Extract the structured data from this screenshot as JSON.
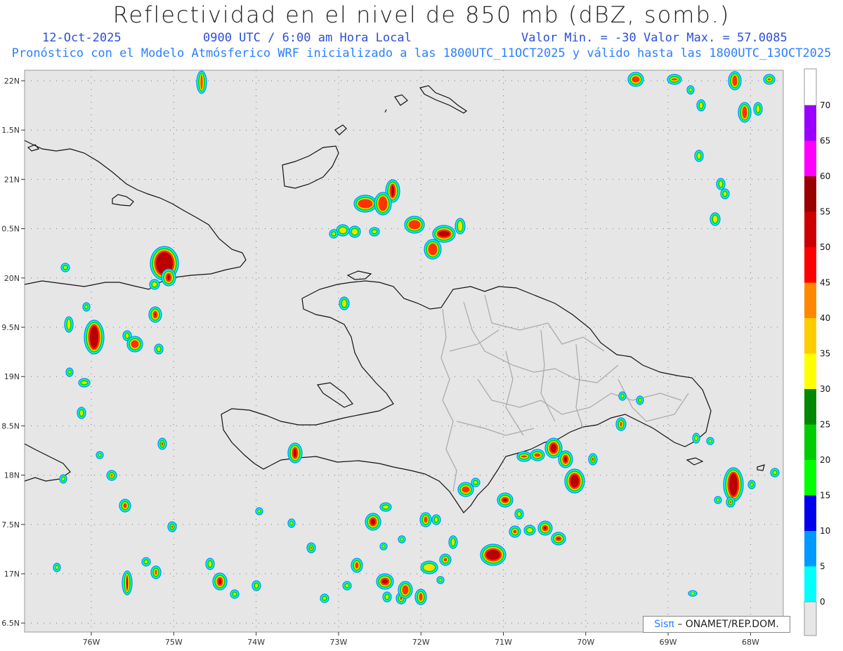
{
  "header": {
    "title": "Reflectividad en el nivel de 850 mb (dBZ, somb.)",
    "date": "12-Oct-2025",
    "time": "0900 UTC / 6:00 am Hora Local",
    "minmax": "Valor Min. = -30  Valor Max. = 57.0085",
    "forecast": "Pronóstico con el Modelo Atmósferico WRF inicializado a las 1800UTC_11OCT2025 y válido hasta las  1800UTC_13OCT2025"
  },
  "map": {
    "lat_labels": [
      "22N",
      "1.5N",
      "21N",
      "0.5N",
      "20N",
      "9.5N",
      "19N",
      "8.5N",
      "18N",
      "7.5N",
      "17N",
      "6.5N"
    ],
    "lon_labels": [
      "76W",
      "75W",
      "74W",
      "73W",
      "72W",
      "71W",
      "70W",
      "69W",
      "68W"
    ],
    "lon_range": [
      -76.63,
      -67.63
    ],
    "lat_range": [
      16.47,
      22.1
    ]
  },
  "colorbar": {
    "labels": [
      "0",
      "5",
      "10",
      "15",
      "20",
      "25",
      "30",
      "35",
      "40",
      "45",
      "50",
      "55",
      "60",
      "65",
      "70"
    ],
    "colors": [
      "#00ffff",
      "#0099ff",
      "#0000ee",
      "#00ff00",
      "#00cc00",
      "#008800",
      "#ffff00",
      "#ffcc00",
      "#ff8800",
      "#ff0000",
      "#cc0000",
      "#990000",
      "#ff00ff",
      "#9900ff"
    ],
    "below_color": "#e6e6e6"
  },
  "credit": {
    "sis": "Sisπ",
    "rest": "– ONAMET/REP.DOM."
  }
}
